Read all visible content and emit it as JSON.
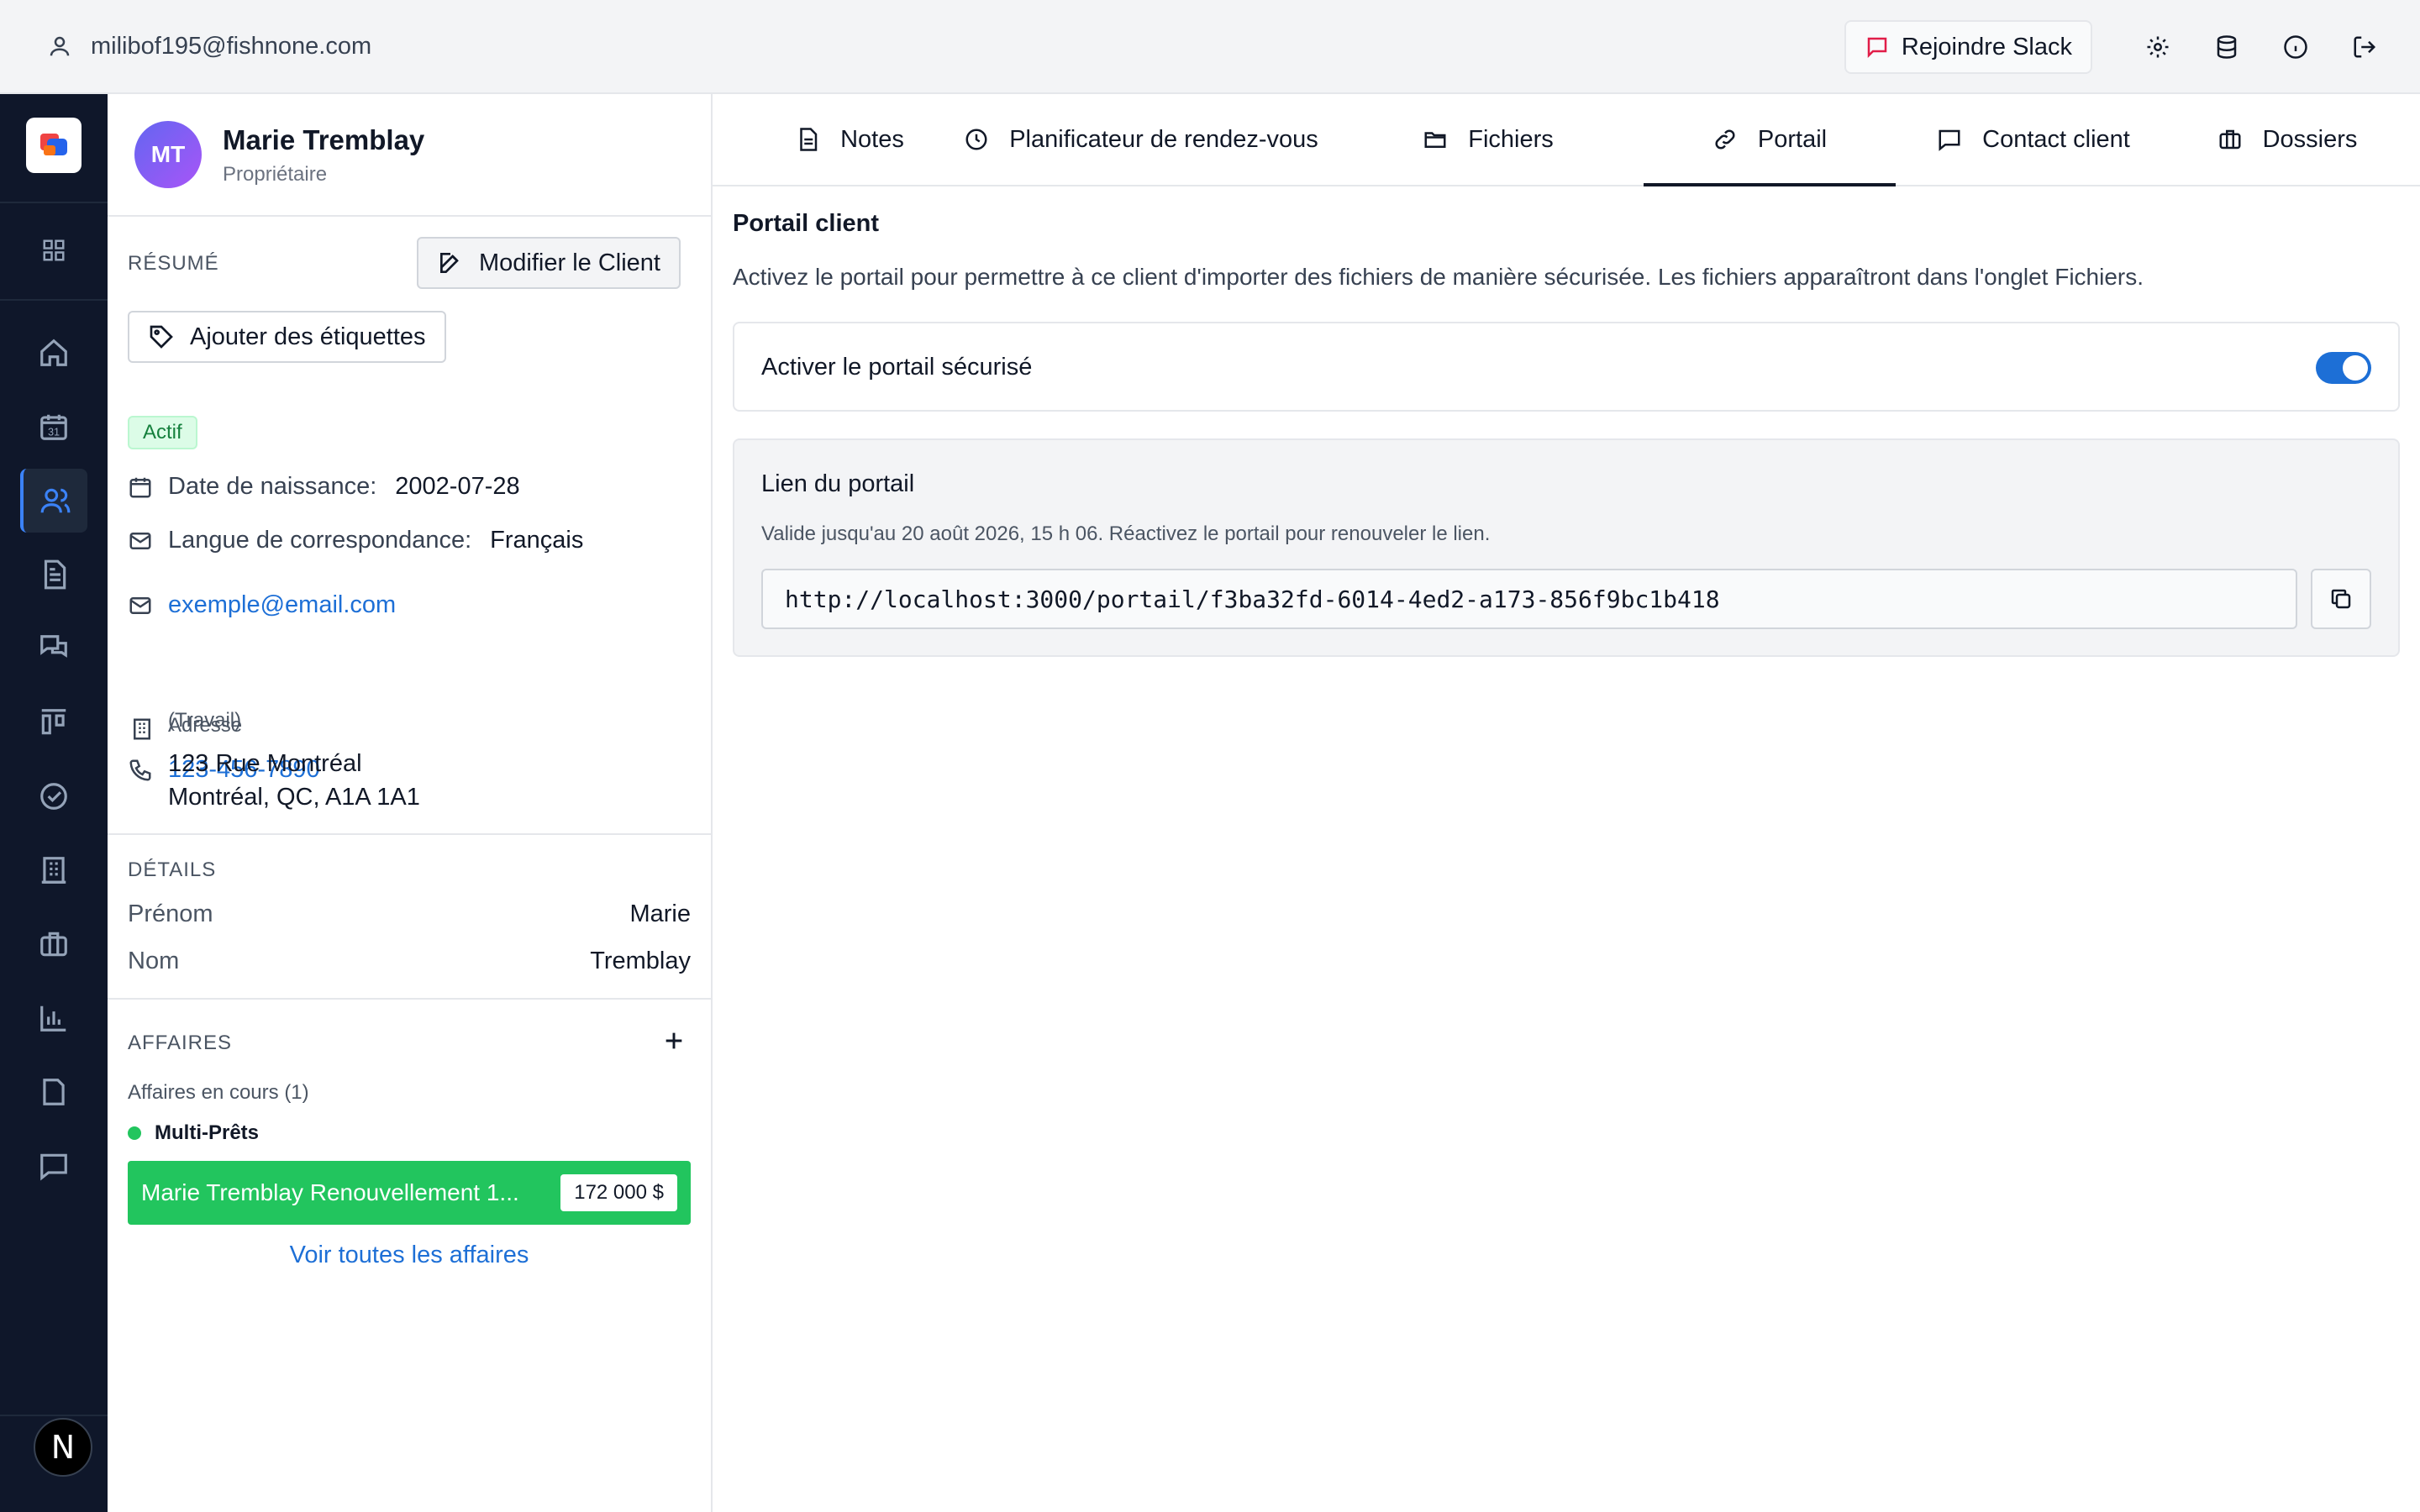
{
  "topbar": {
    "user_email": "milibof195@fishnone.com",
    "slack_label": "Rejoindre Slack",
    "icons": [
      "settings-icon",
      "database-icon",
      "info-icon",
      "logout-icon"
    ]
  },
  "rail": {
    "items": [
      "grid-icon",
      "home-icon",
      "calendar-icon",
      "users-icon",
      "document-icon",
      "chat-icon",
      "kanban-icon",
      "check-circle-icon",
      "building-icon",
      "briefcase-icon",
      "chart-icon",
      "file-icon",
      "message-icon"
    ],
    "active": "users-icon",
    "calendar_day": "31",
    "badge": "N"
  },
  "client": {
    "initials": "MT",
    "name": "Marie Tremblay",
    "role": "Propriétaire",
    "summary_title": "RÉSUMÉ",
    "edit_label": "Modifier le Client",
    "tags_label": "Ajouter des étiquettes",
    "status": "Actif",
    "dob_label": "Date de naissance:",
    "dob_value": "2002-07-28",
    "lang_label": "Langue de correspondance:",
    "lang_value": "Français",
    "email": "exemple@email.com",
    "email_type": "(Travail)",
    "phone": "123-456-7890",
    "address_label": "Adresse",
    "address_line1": "123 Rue Montréal",
    "address_line2": "Montréal, QC, A1A 1A1",
    "details_title": "DÉTAILS",
    "details": [
      {
        "label": "Prénom",
        "value": "Marie"
      },
      {
        "label": "Nom",
        "value": "Tremblay"
      }
    ],
    "deals_title": "AFFAIRES",
    "deals_in_progress": "Affaires en cours (1)",
    "deal_group": "Multi-Prêts",
    "deal_title": "Marie Tremblay Renouvellement 1...",
    "deal_amount": "172 000 $",
    "see_all": "Voir toutes les affaires"
  },
  "tabs": [
    {
      "label": "Notes",
      "icon": "note-icon"
    },
    {
      "label": "Planificateur de rendez-vous",
      "icon": "clock-icon"
    },
    {
      "label": "Fichiers",
      "icon": "folder-icon"
    },
    {
      "label": "Portail",
      "icon": "link-icon"
    },
    {
      "label": "Contact client",
      "icon": "message-icon"
    },
    {
      "label": "Dossiers",
      "icon": "briefcase-icon"
    }
  ],
  "active_tab": "Portail",
  "portal": {
    "title": "Portail client",
    "description": "Activez le portail pour permettre à ce client d'importer des fichiers de manière sécurisée. Les fichiers apparaîtront dans l'onglet Fichiers.",
    "toggle_label": "Activer le portail sécurisé",
    "toggle_on": true,
    "link_title": "Lien du portail",
    "valid_text": "Valide jusqu'au 20 août 2026, 15 h 06. Réactivez le portail pour renouveler le lien.",
    "url": "http://localhost:3000/portail/f3ba32fd-6014-4ed2-a173-856f9bc1b418"
  },
  "colors": {
    "accent": "#1d6fd6",
    "rail_bg": "#0f172a",
    "deal_green": "#22c55e",
    "status_green": "#15803d"
  }
}
